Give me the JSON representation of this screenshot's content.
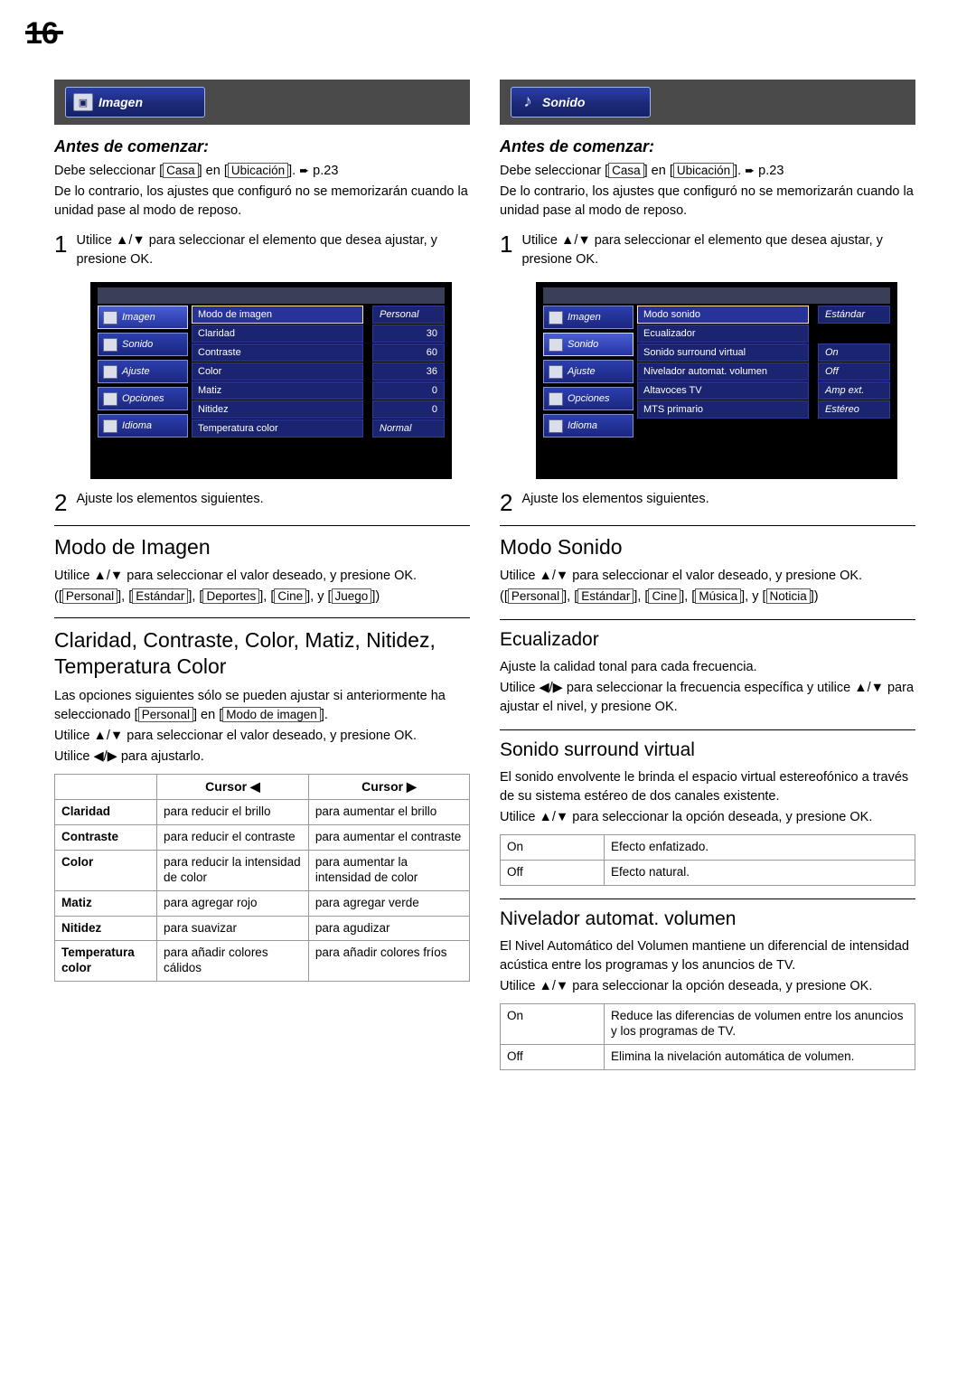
{
  "page": {
    "number": "16"
  },
  "left": {
    "tab": {
      "label": "Imagen",
      "icon": "picture-icon"
    },
    "antes_title": "Antes de comenzar:",
    "pre1_a": "Debe seleccionar [",
    "pre1_casa": "Casa",
    "pre1_b": "] en [",
    "pre1_ubic": "Ubicación",
    "pre1_c": "].",
    "pre1_page": "p.23",
    "pre2": "De lo contrario, los ajustes que configuró no se memorizarán cuando la unidad pase al modo de reposo.",
    "step1_num": "1",
    "step1_text": "Utilice ▲/▼ para seleccionar el elemento que desea ajustar, y presione OK.",
    "osd": {
      "menu": [
        {
          "label": "Imagen",
          "selected": true
        },
        {
          "label": "Sonido",
          "selected": false
        },
        {
          "label": "Ajuste",
          "selected": false
        },
        {
          "label": "Opciones",
          "selected": false
        },
        {
          "label": "Idioma",
          "selected": false
        }
      ],
      "rows": [
        {
          "label": "Modo de imagen",
          "value": "Personal",
          "highlight": true,
          "italic": true
        },
        {
          "label": "Claridad",
          "value": "30",
          "highlight": false,
          "italic": false
        },
        {
          "label": "Contraste",
          "value": "60",
          "highlight": false,
          "italic": false
        },
        {
          "label": "Color",
          "value": "36",
          "highlight": false,
          "italic": false
        },
        {
          "label": "Matiz",
          "value": "0",
          "highlight": false,
          "italic": false
        },
        {
          "label": "Nitidez",
          "value": "0",
          "highlight": false,
          "italic": false
        },
        {
          "label": "Temperatura color",
          "value": "Normal",
          "highlight": false,
          "italic": true
        }
      ]
    },
    "step2_num": "2",
    "step2_text": "Ajuste los elementos siguientes.",
    "sec1_title": "Modo de Imagen",
    "sec1_p1": "Utilice ▲/▼ para seleccionar el valor deseado, y presione OK.",
    "sec1_opts_pre": "([",
    "sec1_opts": [
      "Personal",
      "Estándar",
      "Deportes",
      "Cine",
      "Juego"
    ],
    "sec2_title": "Claridad, Contraste, Color, Matiz, Nitidez, Temperatura Color",
    "sec2_p1_a": "Las opciones siguientes sólo se pueden ajustar si anteriormente ha seleccionado [",
    "sec2_p1_personal": "Personal",
    "sec2_p1_b": "] en [",
    "sec2_p1_modo": "Modo de imagen",
    "sec2_p1_c": "].",
    "sec2_p2": "Utilice ▲/▼ para seleccionar el valor deseado, y presione OK.",
    "sec2_p3": "Utilice ◀/▶ para ajustarlo.",
    "table": {
      "headers": [
        "",
        "Cursor ◀",
        "Cursor ▶"
      ],
      "rows": [
        [
          "Claridad",
          "para reducir el brillo",
          "para aumentar el brillo"
        ],
        [
          "Contraste",
          "para reducir el contraste",
          "para aumentar el contraste"
        ],
        [
          "Color",
          "para reducir la intensidad de color",
          "para aumentar la intensidad de color"
        ],
        [
          "Matiz",
          "para agregar rojo",
          "para agregar verde"
        ],
        [
          "Nitidez",
          "para suavizar",
          "para agudizar"
        ],
        [
          "Temperatura color",
          "para añadir colores cálidos",
          "para añadir colores fríos"
        ]
      ]
    }
  },
  "right": {
    "tab": {
      "label": "Sonido",
      "icon": "music-note-icon"
    },
    "antes_title": "Antes de comenzar:",
    "pre1_a": "Debe seleccionar [",
    "pre1_casa": "Casa",
    "pre1_b": "] en [",
    "pre1_ubic": "Ubicación",
    "pre1_c": "].",
    "pre1_page": "p.23",
    "pre2": "De lo contrario, los ajustes que configuró no se memorizarán cuando la unidad pase al modo de reposo.",
    "step1_num": "1",
    "step1_text": "Utilice ▲/▼ para seleccionar el elemento que desea ajustar, y presione OK.",
    "osd": {
      "menu": [
        {
          "label": "Imagen",
          "selected": false
        },
        {
          "label": "Sonido",
          "selected": true
        },
        {
          "label": "Ajuste",
          "selected": false
        },
        {
          "label": "Opciones",
          "selected": false
        },
        {
          "label": "Idioma",
          "selected": false
        }
      ],
      "rows": [
        {
          "label": "Modo sonido",
          "value": "Estándar",
          "highlight": true,
          "italic": true
        },
        {
          "label": "Ecualizador",
          "value": "",
          "highlight": false,
          "italic": false
        },
        {
          "label": "Sonido surround virtual",
          "value": "On",
          "highlight": false,
          "italic": true
        },
        {
          "label": "Nivelador automat. volumen",
          "value": "Off",
          "highlight": false,
          "italic": true
        },
        {
          "label": "Altavoces TV",
          "value": "Amp ext.",
          "highlight": false,
          "italic": true
        },
        {
          "label": "MTS primario",
          "value": "Estéreo",
          "highlight": false,
          "italic": true
        }
      ]
    },
    "step2_num": "2",
    "step2_text": "Ajuste los elementos siguientes.",
    "sec1_title": "Modo Sonido",
    "sec1_p1": "Utilice ▲/▼ para seleccionar el valor deseado, y presione OK.",
    "sec1_opts": [
      "Personal",
      "Estándar",
      "Cine",
      "Música",
      "Noticia"
    ],
    "sec2_title": "Ecualizador",
    "sec2_p1": "Ajuste la calidad tonal para cada frecuencia.",
    "sec2_p2": "Utilice ◀/▶ para seleccionar la frecuencia específica y utilice ▲/▼ para ajustar el nivel, y presione OK.",
    "sec3_title": "Sonido surround virtual",
    "sec3_p1": "El sonido envolvente le brinda el espacio virtual estereofónico a través de su sistema estéreo de dos canales existente.",
    "sec3_p2": "Utilice ▲/▼ para seleccionar la opción deseada, y presione OK.",
    "sec3_table": [
      [
        "On",
        "Efecto enfatizado."
      ],
      [
        "Off",
        "Efecto natural."
      ]
    ],
    "sec4_title": "Nivelador automat. volumen",
    "sec4_p1": "El Nivel Automático del Volumen mantiene un diferencial de intensidad acústica entre los programas y los anuncios de TV.",
    "sec4_p2": "Utilice ▲/▼ para seleccionar la opción deseada, y presione OK.",
    "sec4_table": [
      [
        "On",
        "Reduce las diferencias de volumen entre los anuncios y los programas de TV."
      ],
      [
        "Off",
        "Elimina la nivelación automática de volumen."
      ]
    ]
  }
}
